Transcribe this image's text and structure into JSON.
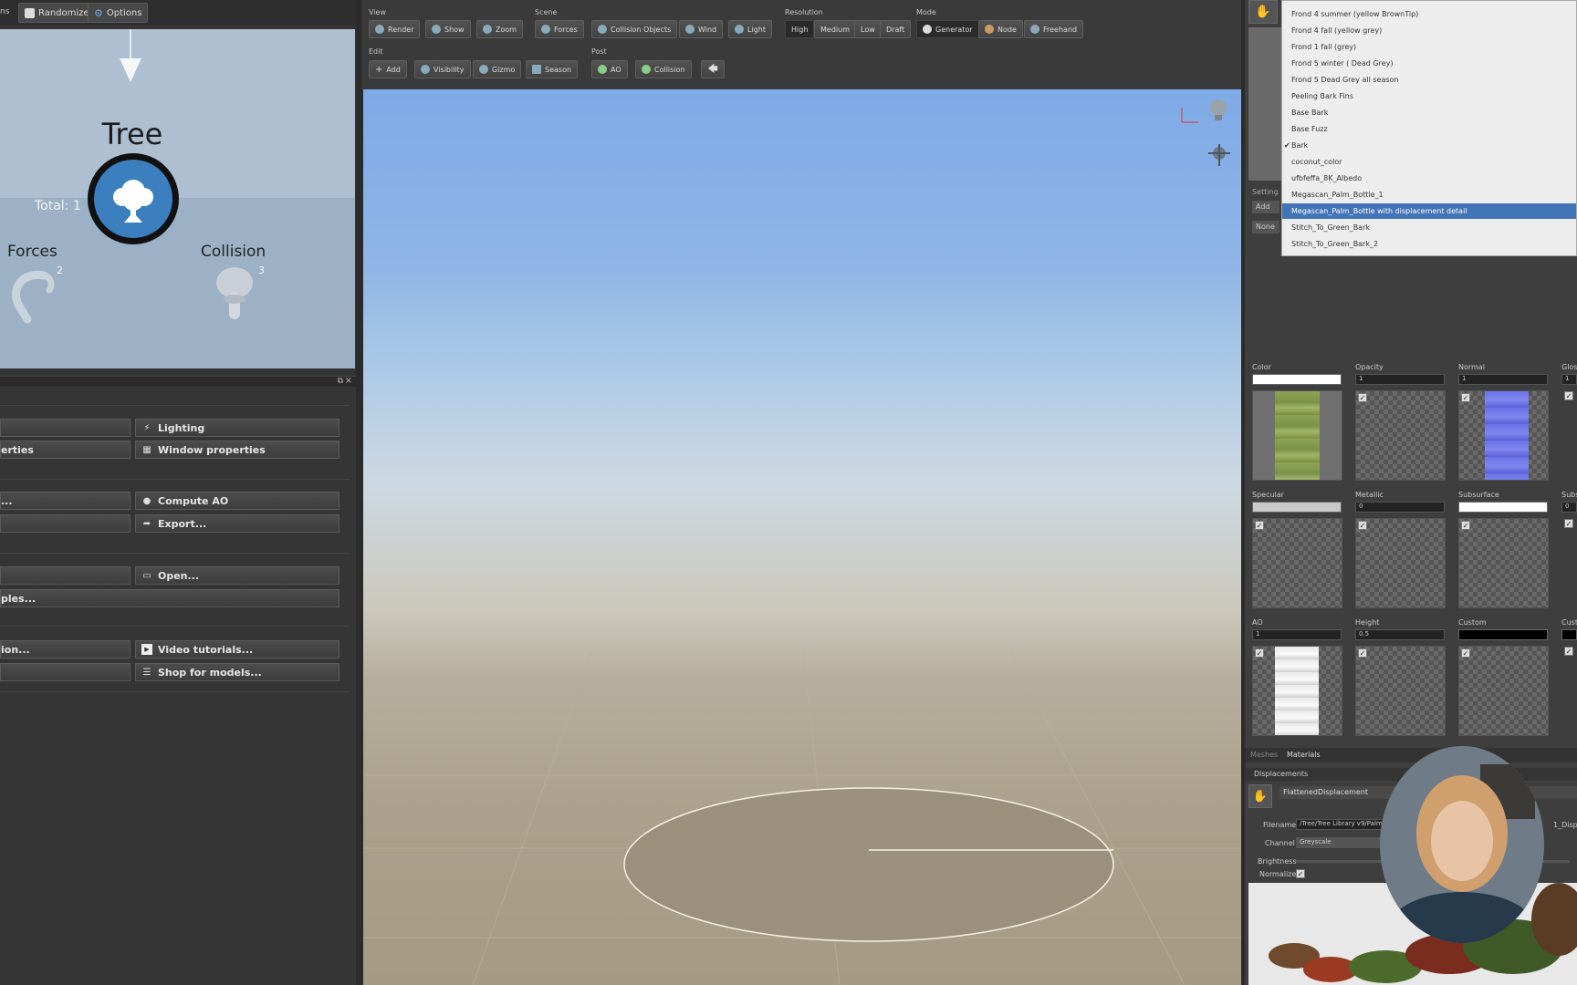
{
  "left_toolbar": {
    "left_fragment": "ns",
    "randomize": "Randomize",
    "options": "Options"
  },
  "canvas": {
    "tree_title": "Tree",
    "total": "Total: 1",
    "forces_label": "Forces",
    "forces_count": "2",
    "collision_label": "Collision",
    "collision_count": "3"
  },
  "panel_buttons": {
    "lighting": "Lighting",
    "window_properties": "Window properties",
    "properties_partial": "erties",
    "ellipsis1": "...",
    "compute_ao": "Compute AO",
    "export": "Export...",
    "open": "Open...",
    "samples_partial": "ples...",
    "option_partial": "ion...",
    "video_tutorials": "Video tutorials...",
    "shop_models": "Shop for models..."
  },
  "toolbar": {
    "view_label": "View",
    "render": "Render",
    "show": "Show",
    "zoom": "Zoom",
    "scene_label": "Scene",
    "forces": "Forces",
    "collision_objects": "Collision Objects",
    "wind": "Wind",
    "light": "Light",
    "resolution_label": "Resolution",
    "high": "High",
    "medium": "Medium",
    "low": "Low",
    "draft": "Draft",
    "mode_label": "Mode",
    "generator": "Generator",
    "node": "Node",
    "freehand": "Freehand",
    "edit_label": "Edit",
    "add": "Add",
    "visibility": "Visibility",
    "gizmo": "Gizmo",
    "season": "Season",
    "post_label": "Post",
    "ao": "AO",
    "collision": "Collision"
  },
  "material_list": {
    "items": [
      "Frond 4 summer (yellow BrownTip)",
      "Frond 4  fall (yellow grey)",
      "Frond 1  fall (grey)",
      "Frond 5 winter ( Dead Grey)",
      "Frond 5 Dead Grey all season",
      "Peeling Bark Fins",
      "Base Bark",
      "Base Fuzz",
      "Bark",
      "coconut_color",
      "ufbfeffa_8K_Albedo",
      "Megascan_Palm_Bottle_1",
      "Megascan_Palm_Bottle with displacement detail",
      "Stitch_To_Green_Bark",
      "Stitch_To_Green_Bark_2"
    ],
    "checked": "Bark",
    "selected": "Megascan_Palm_Bottle with displacement detail"
  },
  "right_panel": {
    "settings_partial": "Setting",
    "add_partial": "Add",
    "none_partial": "None",
    "color_label": "Color",
    "opacity_label": "Opacity",
    "opacity_value": "1",
    "normal_label": "Normal",
    "normal_value": "1",
    "gloss_label": "Glos",
    "gloss_value": "1",
    "specular_label": "Specular",
    "metallic_label": "Metallic",
    "metallic_value": "0",
    "subsurface_label": "Subsurface",
    "subs_partial": "Subs",
    "subs_value": "0",
    "ao_label": "AO",
    "ao_value": "1",
    "height_label": "Height",
    "height_value": "0.5",
    "custom_label": "Custom",
    "cust_partial": "Cust",
    "tab_meshes": "Meshes",
    "tab_materials": "Materials",
    "displacements_label": "Displacements",
    "displacement_name": "FlattenedDisplacement",
    "filename_label": "Filename",
    "filename_value": "/Tree/Tree Library v9/Palm",
    "filename_suffix": "1_Disp",
    "channel_label": "Channel",
    "channel_value": "Greyscale",
    "brightness_label": "Brightness",
    "normalize_label": "Normalize"
  },
  "colors": {
    "accent_selection": "#4274b8",
    "sky_top": "#7eaae6",
    "ground": "#a59b84"
  }
}
